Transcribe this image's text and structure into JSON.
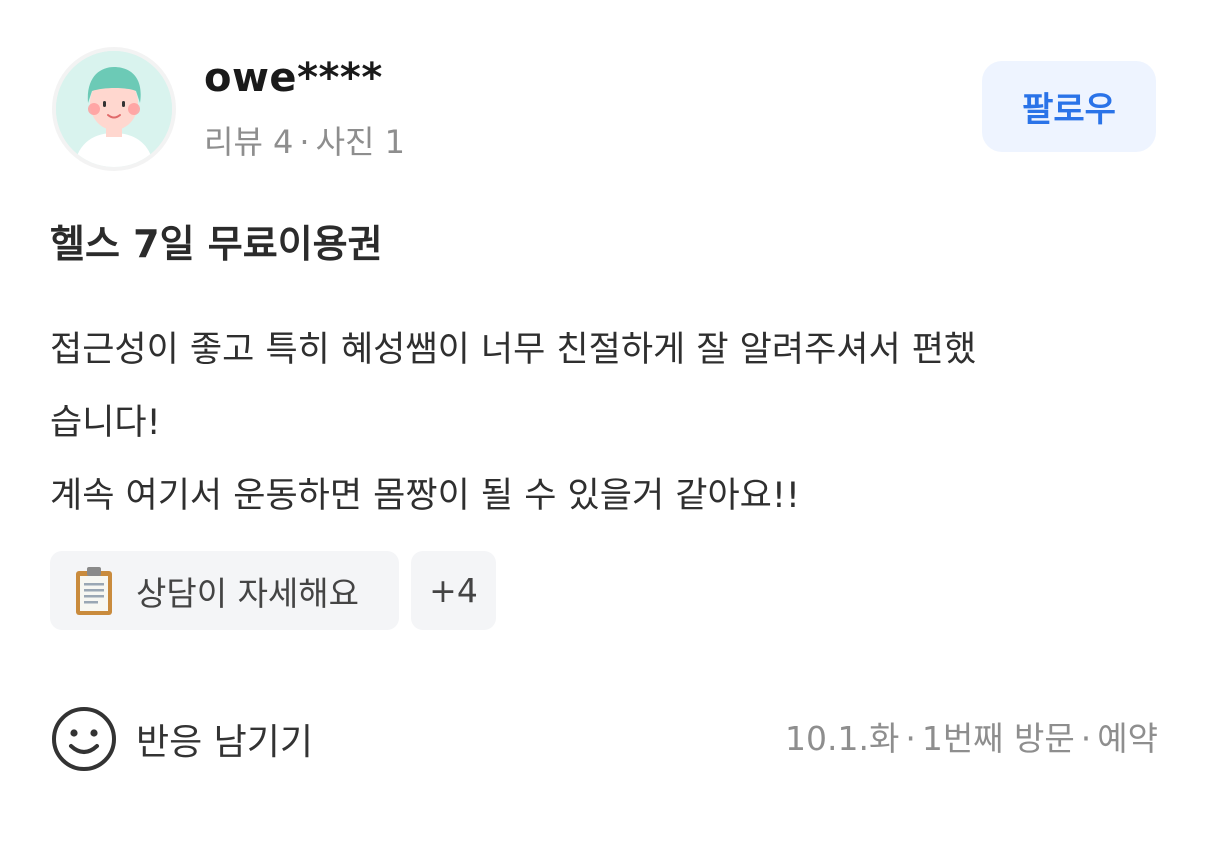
{
  "user": {
    "name": "owe****",
    "reviews_label": "리뷰 4",
    "photos_label": "사진 1",
    "separator": "·",
    "avatar_icon": "user-avatar-icon"
  },
  "follow": {
    "label": "팔로우",
    "color": "#2a73e8",
    "background": "#eef4ff"
  },
  "review": {
    "title": "헬스 7일 무료이용권",
    "body_lines": [
      "접근성이 좋고 특히 혜성쌤이 너무 친절하게 잘 알려주셔서 편했",
      "습니다!",
      "계속 여기서 운동하면 몸짱이 될 수 있을거 같아요!!"
    ]
  },
  "tags": {
    "main": {
      "icon": "clipboard-icon",
      "label": "상담이 자세해요"
    },
    "more_label": "+4"
  },
  "reaction": {
    "icon": "smile-icon",
    "label": "반응 남기기"
  },
  "visit": {
    "date": "10.1.화",
    "count": "1번째 방문",
    "type": "예약",
    "separator": "·"
  }
}
